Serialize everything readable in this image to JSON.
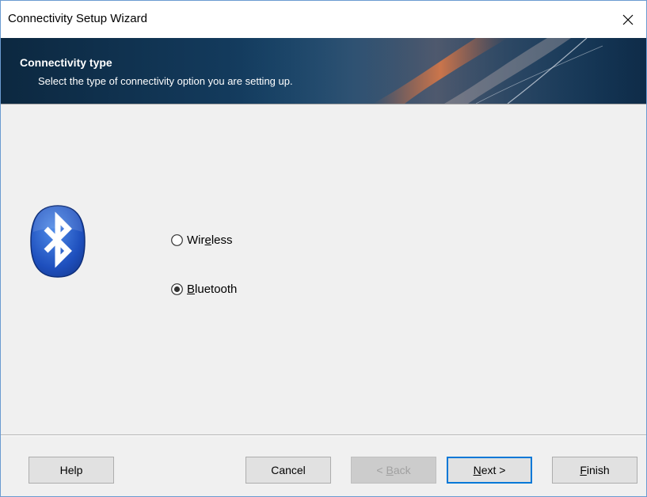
{
  "window": {
    "title": "Connectivity Setup Wizard"
  },
  "banner": {
    "title": "Connectivity type",
    "subtitle": "Select the type of connectivity option you are setting up."
  },
  "options": [
    {
      "pre": "Wir",
      "key": "e",
      "post": "less",
      "checked": false
    },
    {
      "pre": "",
      "key": "B",
      "post": "luetooth",
      "checked": true
    }
  ],
  "buttons": {
    "help": "Help",
    "cancel": "Cancel",
    "back": {
      "pre": "< ",
      "key": "B",
      "post": "ack"
    },
    "next": {
      "pre": "",
      "key": "N",
      "post": "ext >"
    },
    "finish": {
      "pre": "",
      "key": "F",
      "post": "inish"
    }
  },
  "icons": {
    "close": "close-icon",
    "logo": "bluetooth-icon"
  }
}
